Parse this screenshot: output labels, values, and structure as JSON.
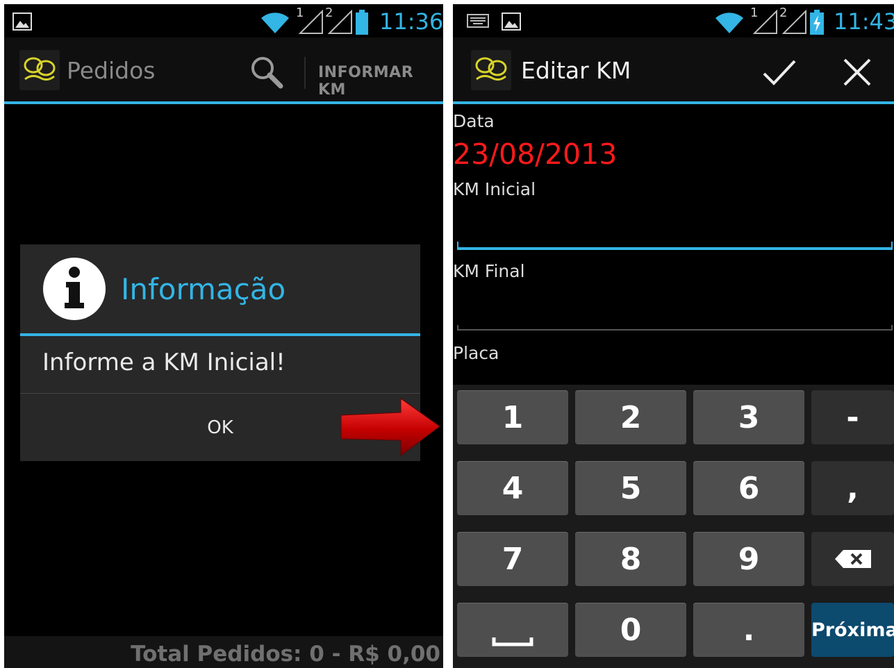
{
  "left": {
    "status_time": "11:36",
    "sim1": "1",
    "sim2": "2",
    "title": "Pedidos",
    "action_informar": "INFORMAR KM",
    "dialog": {
      "title": "Informação",
      "message": "Informe a KM Inicial!",
      "ok": "OK"
    },
    "footer": "Total Pedidos: 0 - R$ 0,00"
  },
  "right": {
    "status_time": "11:43",
    "sim1": "1",
    "sim2": "2",
    "title": "Editar KM",
    "form": {
      "data_label": "Data",
      "data_value": "23/08/2013",
      "km_inicial_label": "KM Inicial",
      "km_inicial_value": "",
      "km_final_label": "KM Final",
      "km_final_value": "",
      "placa_label": "Placa"
    },
    "keyboard": {
      "keys": [
        "1",
        "2",
        "3",
        "-",
        "4",
        "5",
        "6",
        ",",
        "7",
        "8",
        "9",
        "0",
        "."
      ],
      "next": "Próxima"
    }
  },
  "colors": {
    "accent": "#33b5e5",
    "date_value": "#ff1a1a",
    "arrow": "#c80000",
    "next_key": "#0c4a6e"
  },
  "icons": [
    "gallery-icon",
    "wifi-icon",
    "signal-icon",
    "battery-icon",
    "keyboard-icon",
    "search-icon",
    "info-icon",
    "check-icon",
    "close-icon",
    "backspace-icon",
    "space-icon",
    "arrow-icon"
  ]
}
